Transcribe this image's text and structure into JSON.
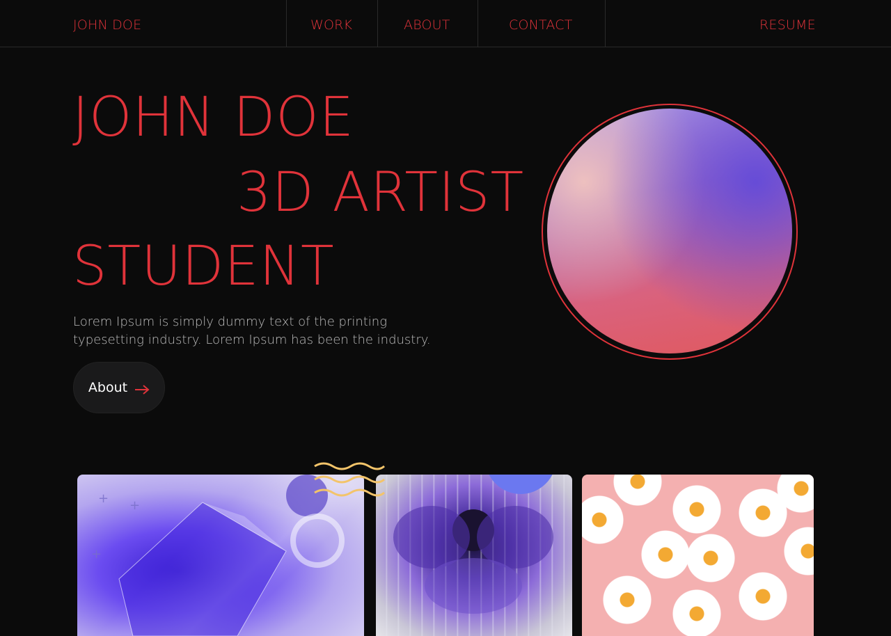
{
  "nav": {
    "logo": "JOHN DOE",
    "links": [
      "WORK",
      "ABOUT",
      "CONTACT"
    ],
    "resume": "RESUME"
  },
  "hero": {
    "line1": "JOHN DOE",
    "line2": "3D ARTIST",
    "line3": "STUDENT",
    "description": "Lorem Ipsum is simply dummy text of the printing typesetting industry. Lorem Ipsum has been the industry.",
    "button_label": "About",
    "button_icon": "arrow-right-icon"
  },
  "colors": {
    "accent": "#e0333a",
    "background": "#0b0b0b",
    "button_bg": "#1a1a1b",
    "wave": "#f3c46a",
    "blob": "#6b78f0"
  },
  "gallery": {
    "cards": [
      "abstract-3d-crystal",
      "purple-flower-glass",
      "daisies-pink"
    ]
  }
}
